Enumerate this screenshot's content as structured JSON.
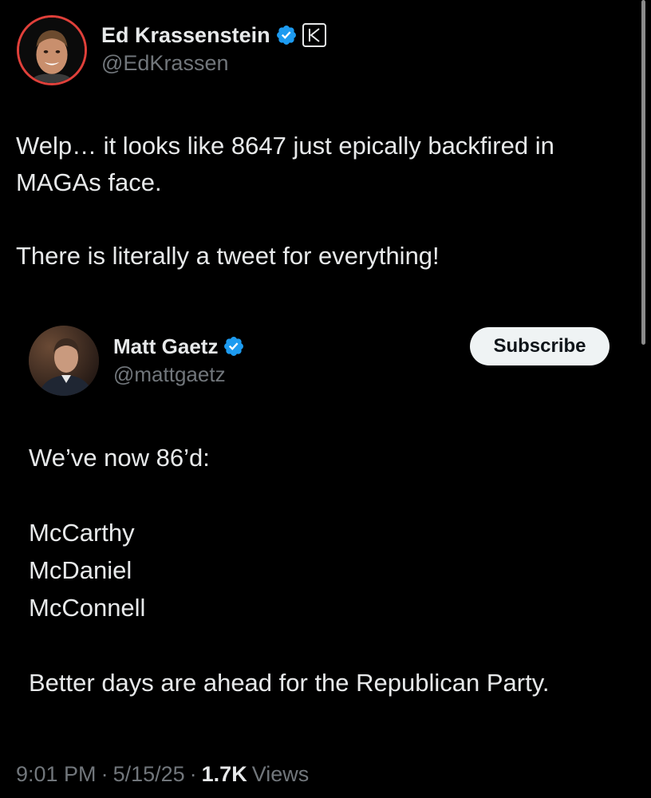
{
  "author": {
    "name": "Ed Krassenstein",
    "handle": "@EdKrassen",
    "verified": true,
    "affiliate_badge_icon": "k-affiliate-icon",
    "avatar_ring_color": "#e0403a"
  },
  "tweet": {
    "paragraphs": [
      [
        "Welp… it looks like 8647 just epically backfired in",
        "MAGAs face."
      ],
      [
        "There is literally a tweet for everything!"
      ]
    ]
  },
  "quoted_tweet": {
    "name": "Matt Gaetz",
    "handle": "@mattgaetz",
    "verified": true,
    "subscribe_label": "Subscribe",
    "lines": [
      "We’ve now 86’d:",
      "McCarthy",
      "McDaniel",
      "McConnell",
      "Better days are ahead for the Republican Party."
    ]
  },
  "meta": {
    "time": "9:01 PM",
    "date": "5/15/25",
    "separator": "·",
    "views_count": "1.7K",
    "views_label": "Views"
  },
  "colors": {
    "background": "#000000",
    "text_primary": "#e7e9ea",
    "text_secondary": "#71767b",
    "verified_blue": "#1d9bf0",
    "button_bg": "#eff3f4",
    "button_text": "#0f1419"
  }
}
